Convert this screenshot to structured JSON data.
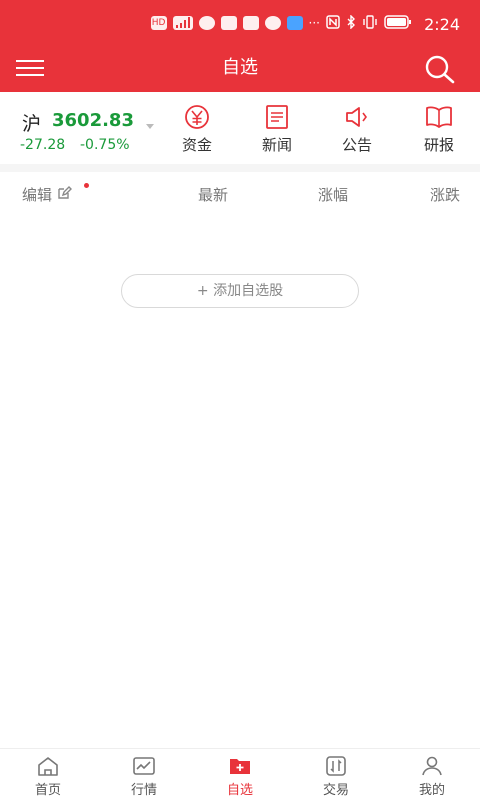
{
  "status_bar": {
    "time": "2:24",
    "icons": [
      "hd-icon",
      "signal-4g-icon",
      "app-icon-1",
      "app-icon-2",
      "app-icon-3",
      "app-icon-4",
      "app-icon-5",
      "more-icon",
      "nfc-icon",
      "bluetooth-icon",
      "vibrate-icon",
      "battery-icon"
    ],
    "hd_label": "HD",
    "more_label": "···"
  },
  "header": {
    "title": "自选",
    "menu_icon": "hamburger-menu-icon",
    "search_icon": "search-icon"
  },
  "index": {
    "name": "沪",
    "value": "3602.83",
    "change": "-27.28",
    "change_pct": "-0.75%",
    "trend_color": "#1a9a3a"
  },
  "quick_links": [
    {
      "label": "资金",
      "icon": "yuan-circle-icon"
    },
    {
      "label": "新闻",
      "icon": "news-doc-icon"
    },
    {
      "label": "公告",
      "icon": "speaker-icon"
    },
    {
      "label": "研报",
      "icon": "open-book-icon"
    }
  ],
  "columns": {
    "edit_label": "编辑",
    "latest_label": "最新",
    "change_pct_label": "涨幅",
    "change_label": "涨跌"
  },
  "add_button": {
    "label": "+ 添加自选股"
  },
  "tabs": [
    {
      "label": "首页",
      "icon": "home-icon",
      "active": false
    },
    {
      "label": "行情",
      "icon": "market-chart-icon",
      "active": false
    },
    {
      "label": "自选",
      "icon": "watchlist-folder-icon",
      "active": true
    },
    {
      "label": "交易",
      "icon": "trade-icon",
      "active": false
    },
    {
      "label": "我的",
      "icon": "profile-icon",
      "active": false
    }
  ],
  "colors": {
    "brand_red": "#e8333a",
    "down_green": "#1a9a3a"
  }
}
